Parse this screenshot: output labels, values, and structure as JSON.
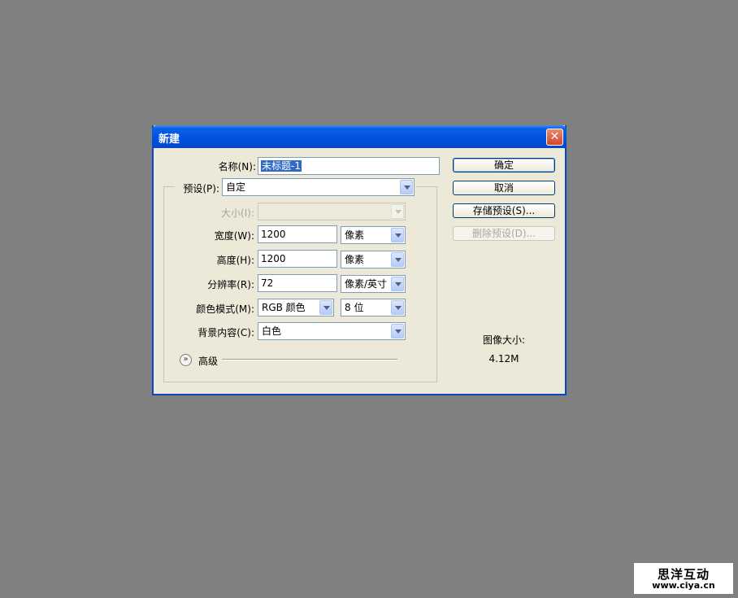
{
  "dialog": {
    "title": "新建",
    "close": "✕",
    "name": {
      "label": "名称(N):",
      "value": "未标题-1"
    },
    "preset": {
      "label": "预设(P):",
      "value": "自定"
    },
    "size": {
      "label": "大小(I):",
      "value": ""
    },
    "width": {
      "label": "宽度(W):",
      "value": "1200",
      "unit": "像素"
    },
    "height": {
      "label": "高度(H):",
      "value": "1200",
      "unit": "像素"
    },
    "resolution": {
      "label": "分辨率(R):",
      "value": "72",
      "unit": "像素/英寸"
    },
    "color_mode": {
      "label": "颜色模式(M):",
      "value": "RGB 颜色",
      "depth": "8 位"
    },
    "background": {
      "label": "背景内容(C):",
      "value": "白色"
    },
    "advanced_label": "高级",
    "buttons": {
      "ok": "确定",
      "cancel": "取消",
      "save_preset": "存储预设(S)...",
      "delete_preset": "删除预设(D)..."
    },
    "image_size": {
      "label": "图像大小:",
      "value": "4.12M"
    }
  },
  "watermark": {
    "name": "思洋互动",
    "url": "www.ciya.cn"
  }
}
